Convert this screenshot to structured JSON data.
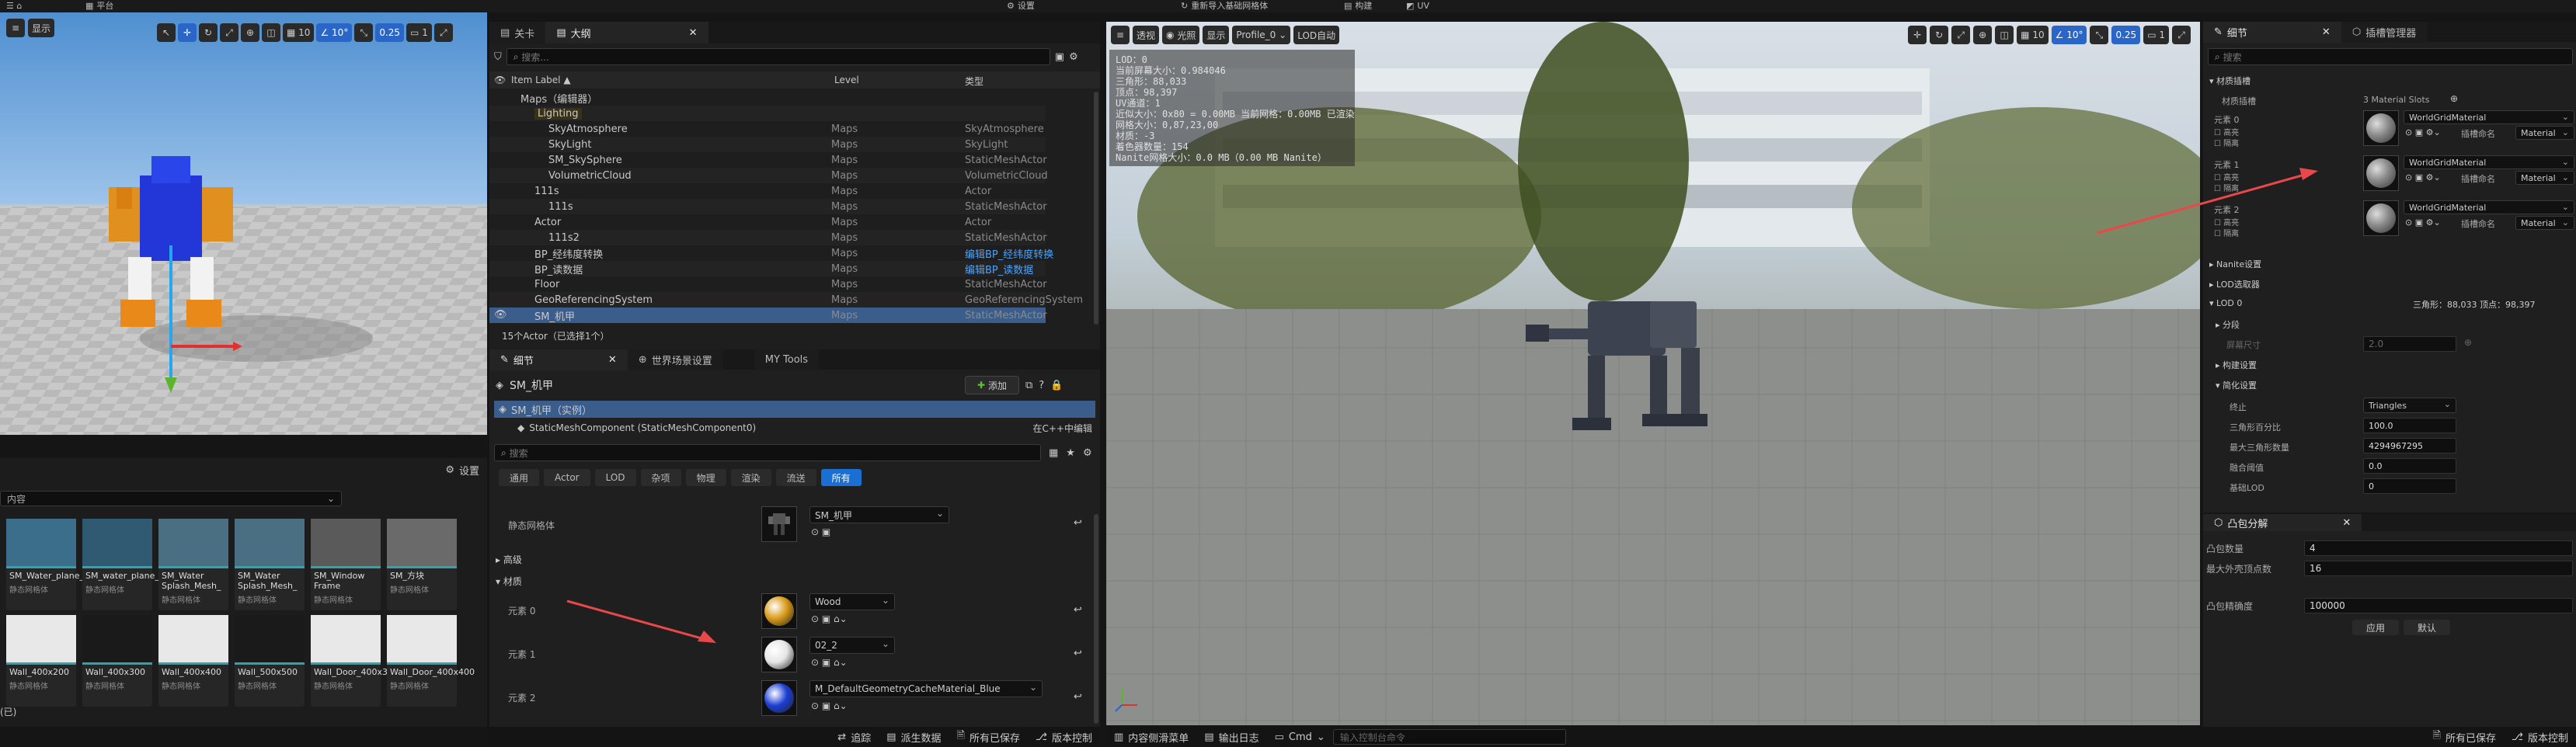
{
  "topbar": {
    "left_label": "平台",
    "settings_label": "设置",
    "mesh_import": "重新导入基础网格体",
    "build_label": "构建",
    "uv_label": "UV"
  },
  "left_viewport": {
    "show_label": "显示",
    "grid_value": "10",
    "angle_value": "10°",
    "scale_value": "0.25",
    "camera_value": "1"
  },
  "content_browser": {
    "settings_label": "设置",
    "filter_label": "内容",
    "assets_row1": [
      {
        "label": "SM_Water_plane_1",
        "type": "静态网格体"
      },
      {
        "label": "SM_water_plane_2",
        "type": "静态网格体"
      },
      {
        "label": "SM_Water Splash_Mesh_",
        "type": "静态网格体"
      },
      {
        "label": "SM_Water Splash_Mesh_",
        "type": "静态网格体"
      },
      {
        "label": "SM_Window Frame",
        "type": "静态网格体"
      },
      {
        "label": "SM_方块",
        "type": "静态网格体"
      }
    ],
    "assets_row2": [
      {
        "label": "Wall_400x200",
        "type": "静态网格体"
      },
      {
        "label": "Wall_400x300",
        "type": "静态网格体"
      },
      {
        "label": "Wall_400x400",
        "type": "静态网格体"
      },
      {
        "label": "Wall_500x500",
        "type": "静态网格体"
      },
      {
        "label": "Wall_Door_400x300",
        "type": "静态网格体"
      },
      {
        "label": "Wall_Door_400x400",
        "type": "静态网格体"
      }
    ],
    "footer_label": "(已)"
  },
  "outliner": {
    "tabs": [
      "关卡",
      "大纲"
    ],
    "search_placeholder": "搜索...",
    "columns": {
      "name": "Item Label ▲",
      "level": "Level",
      "type": "类型"
    },
    "rows": [
      {
        "name": "Maps（编辑器）",
        "level": "",
        "type": "",
        "indent": 0
      },
      {
        "name": "Lighting",
        "level": "",
        "type": "",
        "indent": 1
      },
      {
        "name": "SkyAtmosphere",
        "level": "Maps",
        "type": "SkyAtmosphere",
        "indent": 2
      },
      {
        "name": "SkyLight",
        "level": "Maps",
        "type": "SkyLight",
        "indent": 2
      },
      {
        "name": "SM_SkySphere",
        "level": "Maps",
        "type": "StaticMeshActor",
        "indent": 2
      },
      {
        "name": "VolumetricCloud",
        "level": "Maps",
        "type": "VolumetricCloud",
        "indent": 2
      },
      {
        "name": "111s",
        "level": "Maps",
        "type": "Actor",
        "indent": 1
      },
      {
        "name": "111s",
        "level": "Maps",
        "type": "StaticMeshActor",
        "indent": 2
      },
      {
        "name": "Actor",
        "level": "Maps",
        "type": "Actor",
        "indent": 1
      },
      {
        "name": "111s2",
        "level": "Maps",
        "type": "StaticMeshActor",
        "indent": 2
      },
      {
        "name": "BP_经纬度转换",
        "level": "Maps",
        "type": "编辑BP_经纬度转换",
        "indent": 1,
        "link": true
      },
      {
        "name": "BP_读数据",
        "level": "Maps",
        "type": "编辑BP_读数据",
        "indent": 1,
        "link": true
      },
      {
        "name": "Floor",
        "level": "Maps",
        "type": "StaticMeshActor",
        "indent": 1
      },
      {
        "name": "GeoReferencingSystem",
        "level": "Maps",
        "type": "GeoReferencingSystem",
        "indent": 1
      },
      {
        "name": "SM_机甲",
        "level": "Maps",
        "type": "StaticMeshActor",
        "indent": 1,
        "selected": true
      }
    ],
    "footer": "15个Actor（已选择1个）"
  },
  "details": {
    "tabs": [
      "细节",
      "世界场景设置",
      "MY Tools"
    ],
    "actor_name": "SM_机甲",
    "add_label": "添加",
    "instance_label": "SM_机甲（实例）",
    "component_label": "StaticMeshComponent (StaticMeshComponent0)",
    "edit_cpp": "在C++中编辑",
    "search_placeholder": "搜索",
    "filter_tabs": [
      "通用",
      "Actor",
      "LOD",
      "杂项",
      "物理",
      "渲染",
      "流送",
      "所有"
    ],
    "static_mesh_label": "静态网格体",
    "static_mesh_value": "SM_机甲",
    "advanced_label": "高级",
    "materials_label": "材质",
    "elements": [
      {
        "label": "元素 0",
        "value": "Wood",
        "color": "#d89a18"
      },
      {
        "label": "元素 1",
        "value": "02_2",
        "color": "#e6e6e6"
      },
      {
        "label": "元素 2",
        "value": "M_DefaultGeometryCacheMaterial_Blue",
        "color": "#1c3ed6"
      }
    ]
  },
  "main_viewport": {
    "perspective": "透视",
    "lit": "光照",
    "show": "显示",
    "profile": "Profile_0",
    "lod": "LOD自动",
    "grid_value": "10",
    "angle_value": "10°",
    "scale_value": "0.25",
    "camera_value": "1",
    "stats_lines": [
      "LOD：0",
      "当前屏幕大小：0.984046",
      "三角形：88,033",
      "顶点：98,397",
      "UV通道：1",
      "近似大小：0x80 = 0.00MB 当前网格：0.00MB 已渲染",
      "网格大小：0,87,23,00",
      "材质：-3",
      "着色器数量：154",
      "Nanite网格大小：0.0 MB（0.00 MB Nanite）"
    ]
  },
  "right_panel": {
    "tabs": [
      "细节",
      "插槽管理器"
    ],
    "search_placeholder": "搜索",
    "material_slots_section": "材质插槽",
    "material_slots_label": "材质插槽",
    "material_slots_count": "3 Material Slots",
    "slots": [
      {
        "label": "元素 0",
        "sub1": "高亮",
        "sub2": "隔离",
        "material": "WorldGridMaterial",
        "slot_name": "插槽命名",
        "slot_value": "Material"
      },
      {
        "label": "元素 1",
        "sub1": "高亮",
        "sub2": "隔离",
        "material": "WorldGridMaterial",
        "slot_name": "插槽命名",
        "slot_value": "Material"
      },
      {
        "label": "元素 2",
        "sub1": "高亮",
        "sub2": "隔离",
        "material": "WorldGridMaterial",
        "slot_name": "插槽命名",
        "slot_value": "Material"
      }
    ],
    "nanite_section": "Nanite设置",
    "lod_picker_section": "LOD选取器",
    "lod0_section": "LOD 0",
    "lod0_stats": "三角形：88,033   顶点：98,397",
    "sections_label": "分段",
    "screen_size_label": "屏幕尺寸",
    "screen_size_value": "2.0",
    "build_settings": "构建设置",
    "reduction_settings": "简化设置",
    "terminate_label": "终止",
    "terminate_value": "Triangles",
    "tri_percent_label": "三角形百分比",
    "tri_percent_value": "100.0",
    "max_tri_label": "最大三角形数量",
    "max_tri_value": "4294967295",
    "weld_label": "融合阈值",
    "weld_value": "0.0",
    "base_lod_label": "基础LOD",
    "base_lod_value": "0"
  },
  "convex": {
    "tab": "凸包分解",
    "hull_count_label": "凸包数量",
    "hull_count_value": "4",
    "max_verts_label": "最大外壳顶点数",
    "max_verts_value": "16",
    "precision_label": "凸包精确度",
    "precision_value": "100000",
    "apply_label": "应用",
    "default_label": "默认"
  },
  "status_left": {
    "trace": "追踪",
    "derived": "派生数据",
    "saved": "所有已保存",
    "version": "版本控制"
  },
  "status_right": {
    "content_drawer": "内容侧滑菜单",
    "output_log": "输出日志",
    "cmd": "Cmd",
    "cmd_placeholder": "输入控制台命令",
    "saved": "所有已保存",
    "version": "版本控制"
  },
  "colors": {
    "accent": "#1b6fd2",
    "arrow": "#e8484a",
    "teal": "#2aa6b3",
    "link": "#4aa3ff"
  }
}
